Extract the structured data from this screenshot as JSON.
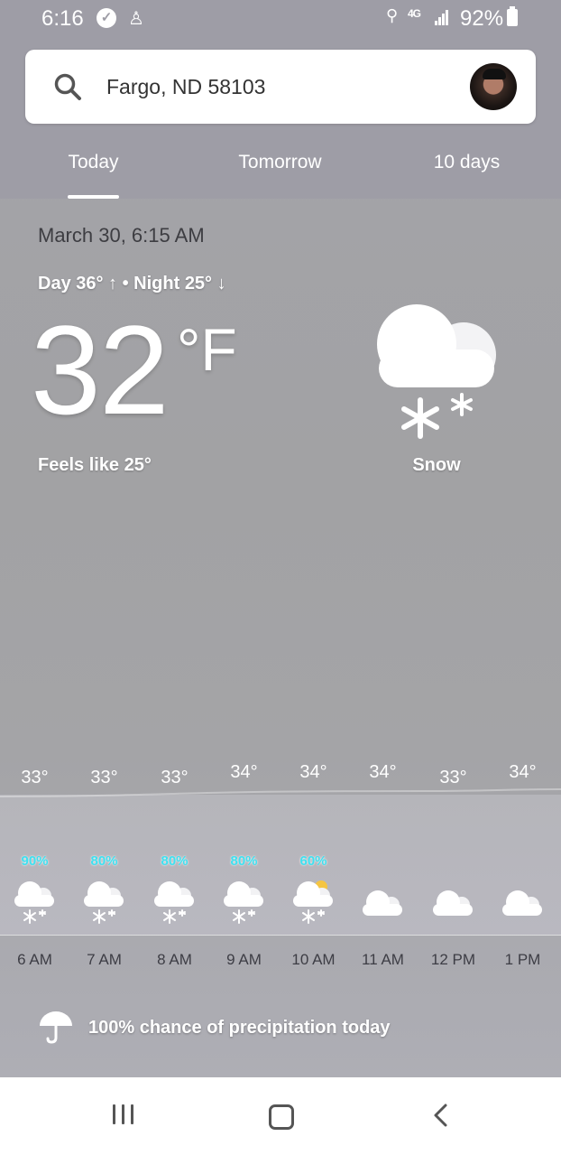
{
  "status_bar": {
    "time": "6:16",
    "network": "4G",
    "battery": "92%",
    "icons": [
      "verified-check-icon",
      "assistant-mic-icon",
      "wifi-calling-icon",
      "signal-icon",
      "battery-icon"
    ]
  },
  "search": {
    "location": "Fargo, ND 58103",
    "icon": "search-icon"
  },
  "tabs": [
    {
      "label": "Today",
      "selected": true
    },
    {
      "label": "Tomorrow",
      "selected": false
    },
    {
      "label": "10 days",
      "selected": false
    }
  ],
  "current": {
    "date_time": "March 30, 6:15 AM",
    "day_night": "Day 36° ↑ • Night 25° ↓",
    "temperature": "32",
    "unit": "°F",
    "feels_like": "Feels like 25°",
    "condition": "Snow",
    "condition_icon": "snow-cloud-icon"
  },
  "hourly": [
    {
      "time": "6 AM",
      "temp": "33°",
      "precip": "90%",
      "icon": "snow-icon"
    },
    {
      "time": "7 AM",
      "temp": "33°",
      "precip": "80%",
      "icon": "snow-icon"
    },
    {
      "time": "8 AM",
      "temp": "33°",
      "precip": "80%",
      "icon": "snow-icon"
    },
    {
      "time": "9 AM",
      "temp": "34°",
      "precip": "80%",
      "icon": "snow-icon"
    },
    {
      "time": "10 AM",
      "temp": "34°",
      "precip": "60%",
      "icon": "snow-partly-sunny-icon"
    },
    {
      "time": "11 AM",
      "temp": "34°",
      "precip": "",
      "icon": "cloud-icon"
    },
    {
      "time": "12 PM",
      "temp": "33°",
      "precip": "",
      "icon": "cloud-icon"
    },
    {
      "time": "1 PM",
      "temp": "34°",
      "precip": "",
      "icon": "cloud-icon"
    }
  ],
  "precipitation_summary": "100% chance of precipitation today",
  "colors": {
    "accent_precip": "#3fe0f0",
    "header": "#9e9da6",
    "sun": "#f5c542"
  },
  "nav": [
    "recents-icon",
    "home-icon",
    "back-icon"
  ]
}
